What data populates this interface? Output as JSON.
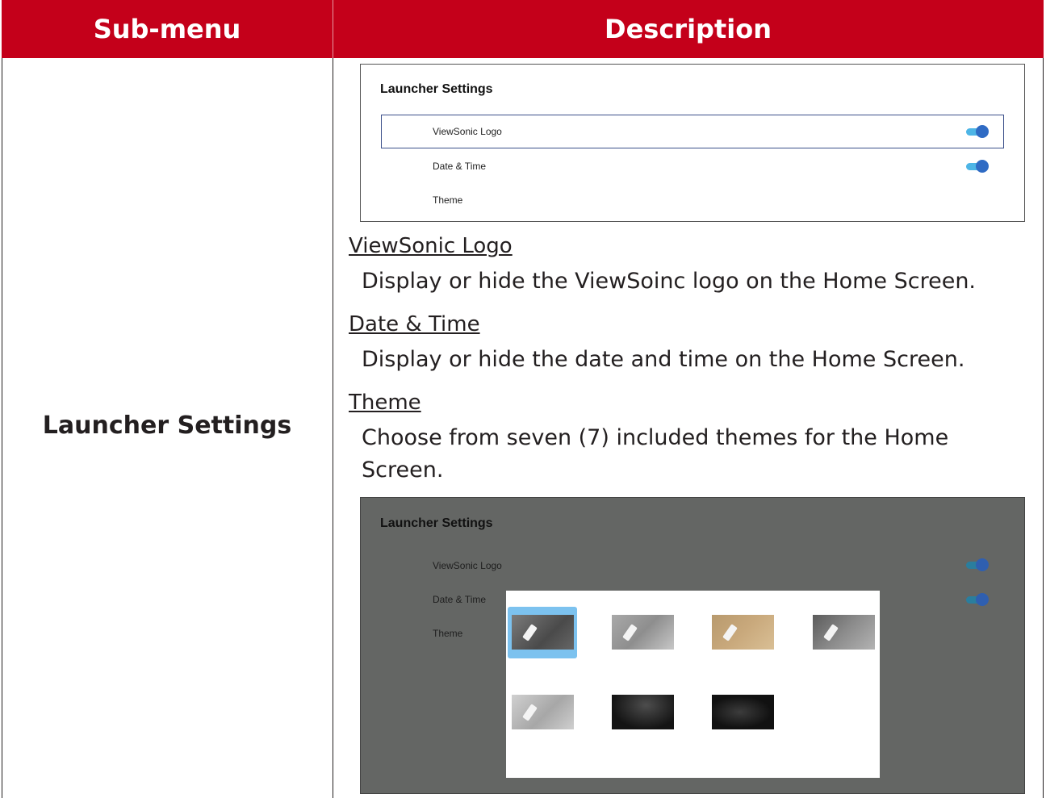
{
  "table": {
    "header_submenu": "Sub-menu",
    "header_description": "Description",
    "submenu_label": "Launcher Settings"
  },
  "screenshot1": {
    "title": "Launcher Settings",
    "rows": [
      "ViewSonic Logo",
      "Date & Time",
      "Theme"
    ],
    "toggles": {
      "viewsonic_logo": "on",
      "date_time": "on"
    }
  },
  "sections": [
    {
      "heading": "ViewSonic Logo",
      "body": "Display or hide the ViewSoinc logo on the Home Screen."
    },
    {
      "heading": "Date & Time",
      "body": "Display or hide the date and time on the Home Screen."
    },
    {
      "heading": "Theme",
      "body": "Choose from seven (7) included themes for the Home Screen."
    }
  ],
  "screenshot2": {
    "title": "Launcher Settings",
    "rows": [
      "ViewSonic Logo",
      "Date & Time",
      "Theme"
    ],
    "theme_count": 7,
    "selected_theme_index": 0
  },
  "colors": {
    "header_bg": "#c4001a",
    "toggle_track": "#4db5e6",
    "toggle_knob": "#2f6bc4",
    "selection": "#7cc2ef"
  }
}
